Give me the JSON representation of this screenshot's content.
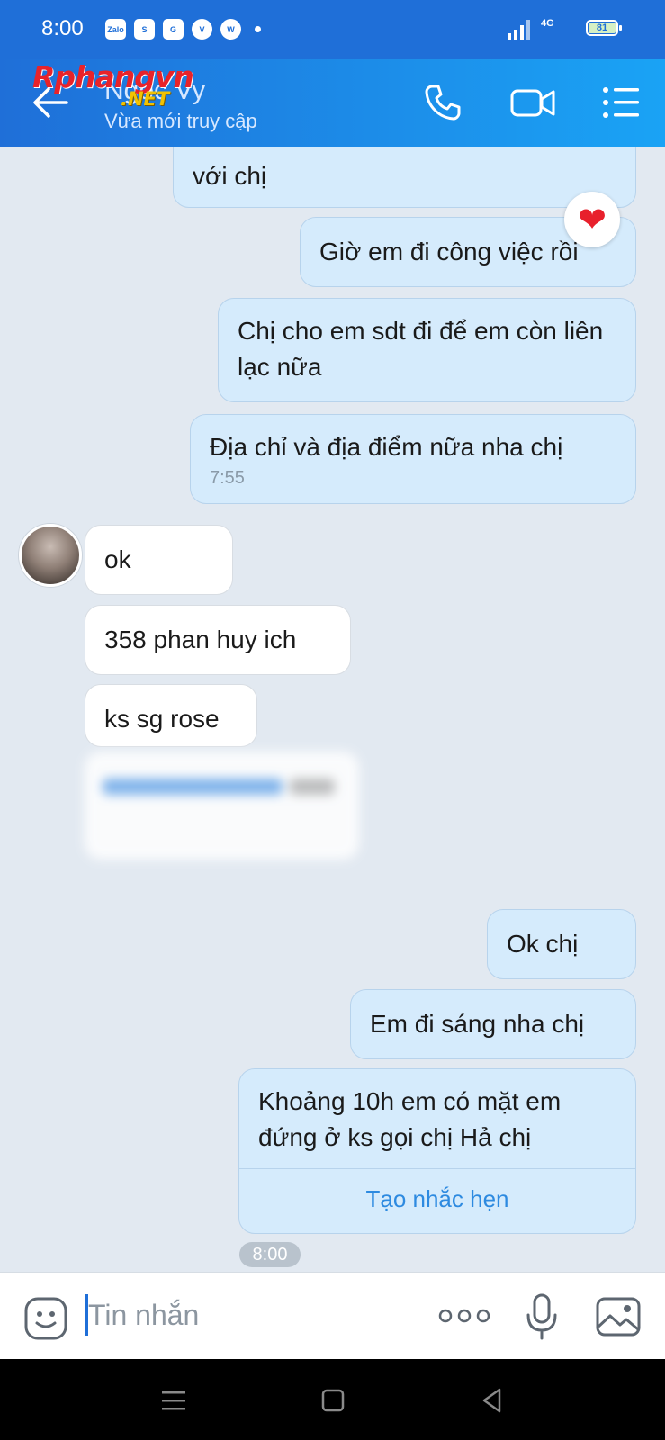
{
  "status_bar": {
    "time": "8:00",
    "apps": [
      "Zalo",
      "S",
      "G",
      "V",
      "W"
    ],
    "network": "4G",
    "battery": "81"
  },
  "header": {
    "contact_name": "Ngọc Vy",
    "contact_status": "Vừa mới truy cập",
    "watermark": "Rphangvn",
    "watermark_suffix": ".NET",
    "icons": [
      "back-arrow-icon",
      "phone-icon",
      "video-call-icon",
      "menu-list-icon"
    ]
  },
  "messages": [
    {
      "side": "out",
      "text": "với chị"
    },
    {
      "side": "out",
      "text": "Giờ em đi công việc rồi"
    },
    {
      "side": "out",
      "text": "Chị cho em sdt đi để em còn liên lạc nữa"
    },
    {
      "side": "out",
      "text": "Địa chỉ và địa điểm nữa nha chị",
      "time": "7:55"
    },
    {
      "side": "in",
      "text": "ok"
    },
    {
      "side": "in",
      "text": "358 phan huy ich"
    },
    {
      "side": "in",
      "text": "ks sg rose"
    },
    {
      "side": "out",
      "text": "Ok chị"
    },
    {
      "side": "out",
      "text": "Em đi sáng nha chị"
    },
    {
      "side": "out",
      "text": "Khoảng 10h em có mặt em đứng ở ks gọi chị Hả chị",
      "action": "Tạo nhắc hẹn"
    }
  ],
  "reaction": "❤",
  "last_time": "8:00",
  "input": {
    "placeholder": "Tin nhắn",
    "value": ""
  },
  "colors": {
    "header_start": "#1f6fd8",
    "header_end": "#1aa3f5",
    "outgoing_bubble": "#d5ebfc",
    "incoming_bubble": "#ffffff",
    "chat_background": "#e2e9f1",
    "link": "#2d8ae0"
  }
}
